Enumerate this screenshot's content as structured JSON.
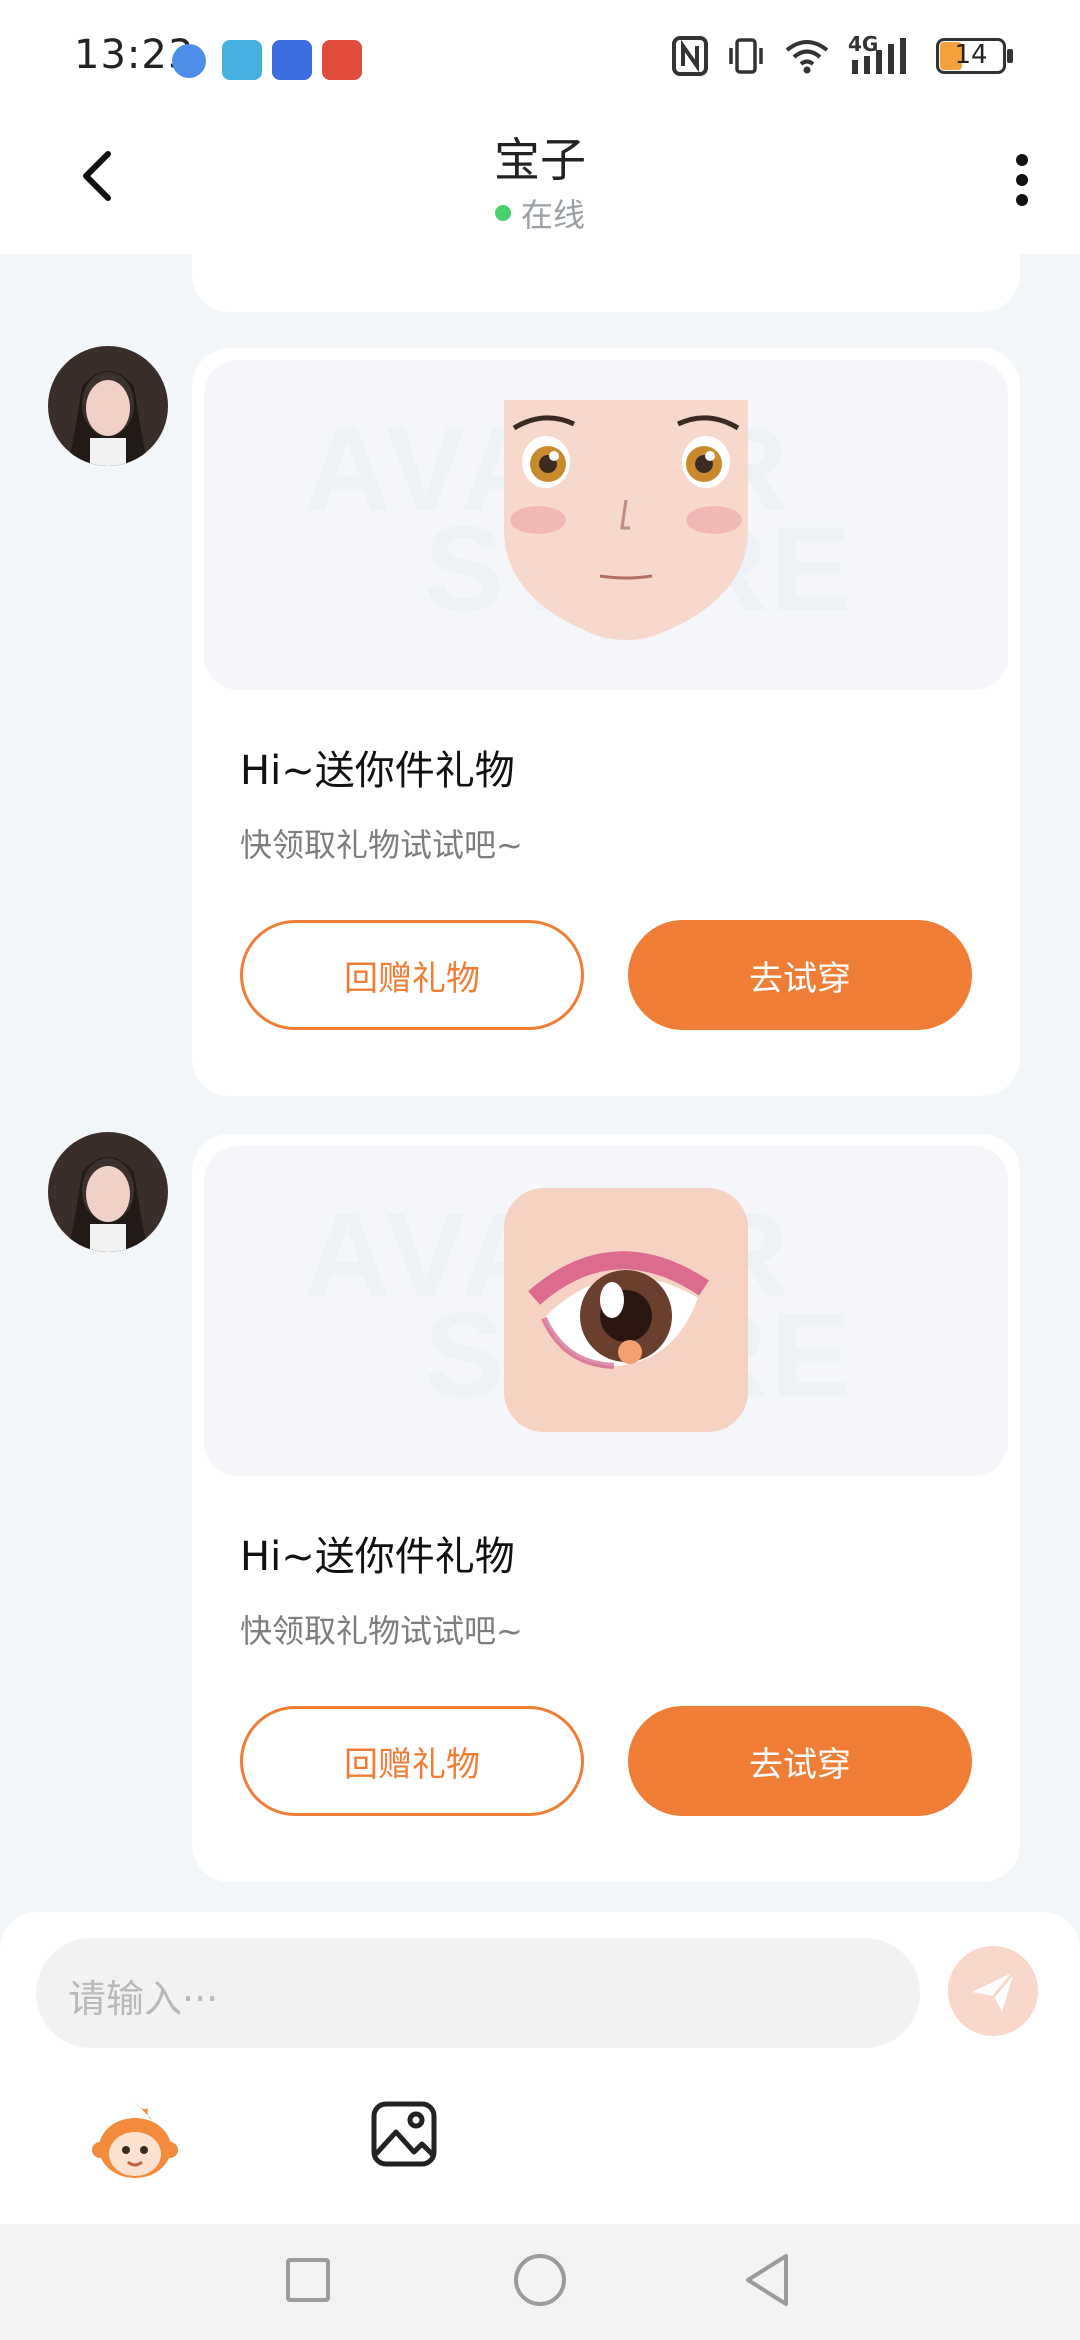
{
  "status_bar": {
    "time": "13:23",
    "battery": "14",
    "network": "4G"
  },
  "header": {
    "title": "宝子",
    "status": "在线"
  },
  "messages": [
    {
      "title": "Hi~送你件礼物",
      "subtitle": "快领取礼物试试吧~",
      "return_gift_label": "回赠礼物",
      "try_on_label": "去试穿",
      "watermark_line1": "AVATAR",
      "watermark_line2": "STORE",
      "item": "face"
    },
    {
      "title": "Hi~送你件礼物",
      "subtitle": "快领取礼物试试吧~",
      "return_gift_label": "回赠礼物",
      "try_on_label": "去试穿",
      "watermark_line1": "AVATAR",
      "watermark_line2": "STORE",
      "item": "eye"
    }
  ],
  "input": {
    "placeholder": "请输入···"
  },
  "colors": {
    "accent": "#ef7d35",
    "online": "#49d16c",
    "send_disabled": "#f9d7cb"
  }
}
